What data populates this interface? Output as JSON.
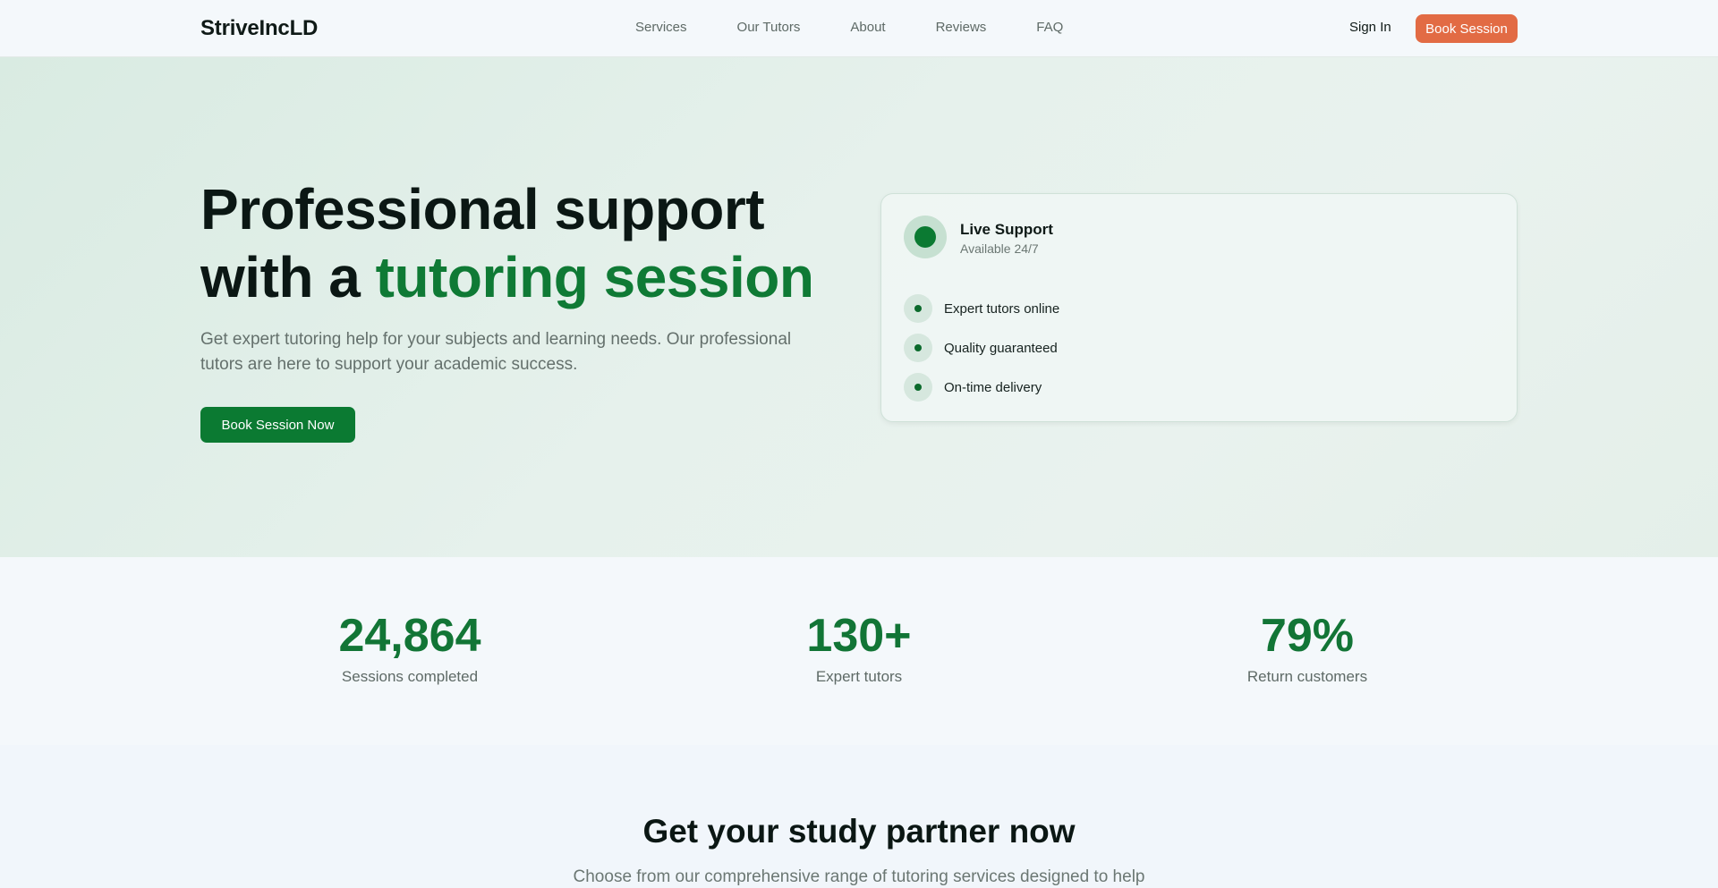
{
  "nav": {
    "brand": "StriveIncLD",
    "links": [
      "Services",
      "Our Tutors",
      "About",
      "Reviews",
      "FAQ"
    ],
    "sign_in": "Sign In",
    "book_session": "Book Session"
  },
  "hero": {
    "title_line1": "Professional support",
    "title_prefix": "with a ",
    "title_accent": "tutoring session",
    "subtitle": "Get expert tutoring help for your subjects and learning needs. Our professional tutors are here to support your academic success.",
    "cta": "Book Session Now"
  },
  "card": {
    "title": "Live Support",
    "subtitle": "Available 24/7",
    "features": [
      "Expert tutors online",
      "Quality guaranteed",
      "On-time delivery"
    ]
  },
  "stats": [
    {
      "value": "24,864",
      "label": "Sessions completed"
    },
    {
      "value": "130+",
      "label": "Expert tutors"
    },
    {
      "value": "79%",
      "label": "Return customers"
    }
  ],
  "partner": {
    "title": "Get your study partner now",
    "subtitle": "Choose from our comprehensive range of tutoring services designed to help"
  },
  "colors": {
    "brand_green": "#0b7a32",
    "accent_orange": "#e26b44",
    "stat_green": "#127536"
  }
}
